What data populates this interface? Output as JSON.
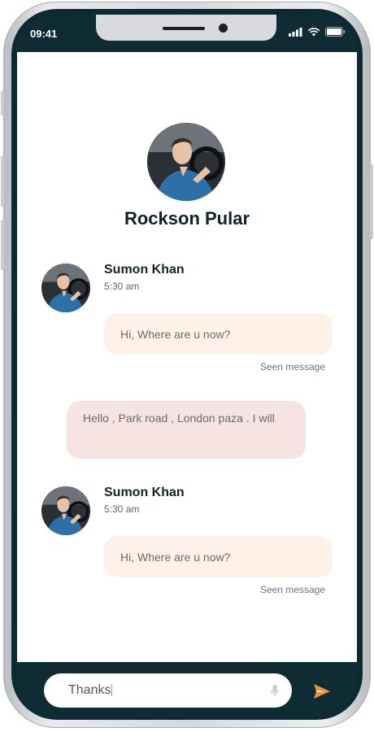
{
  "status_bar": {
    "time": "09:41"
  },
  "profile": {
    "name": "Rockson Pular"
  },
  "messages": [
    {
      "sender": "Sumon Khan",
      "time": "5:30 am",
      "text": "Hi, Where are u now?",
      "status": "Seen message"
    },
    {
      "reply": "Hello , Park road , London paza . I will"
    },
    {
      "sender": "Sumon Khan",
      "time": "5:30 am",
      "text": "Hi, Where are u now?",
      "status": "Seen message"
    }
  ],
  "composer": {
    "value": "Thanks"
  },
  "icons": {
    "signal": "signal-icon",
    "wifi": "wifi-icon",
    "battery": "battery-icon",
    "mic": "microphone-icon",
    "send": "send-icon"
  },
  "colors": {
    "frame_dark": "#0f2b33",
    "incoming_bubble": "#fdf1e8",
    "outgoing_bubble": "#f8e3e3",
    "send_accent": "#f0922f"
  }
}
